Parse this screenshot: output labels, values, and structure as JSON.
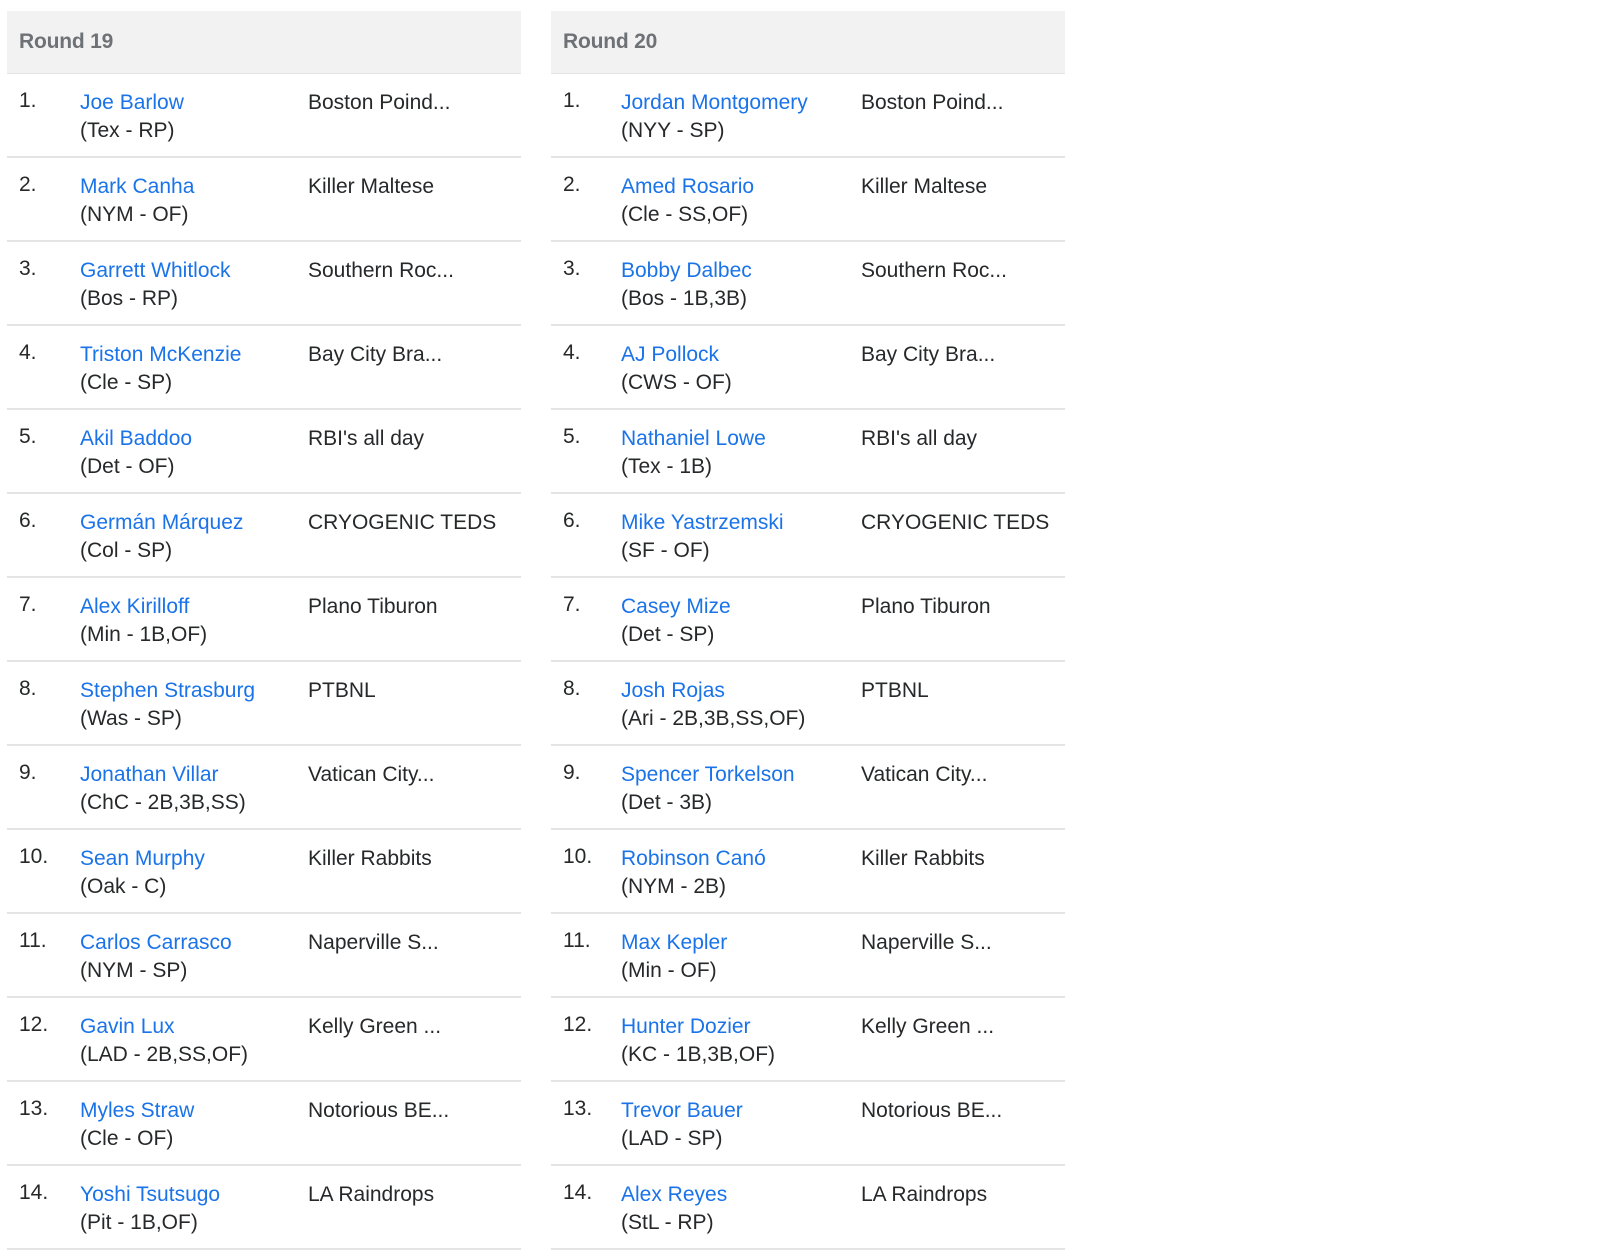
{
  "colors": {
    "link": "#1a73e8",
    "header_bg": "#f2f2f2",
    "header_text": "#6e7276",
    "divider": "#e4e4e4",
    "text": "#26282a"
  },
  "rounds": [
    {
      "title": "Round 19",
      "picks": [
        {
          "num": "1.",
          "player": "Joe Barlow",
          "meta": "(Tex - RP)",
          "team": "Boston Poind..."
        },
        {
          "num": "2.",
          "player": "Mark Canha",
          "meta": "(NYM - OF)",
          "team": "Killer Maltese"
        },
        {
          "num": "3.",
          "player": "Garrett Whitlock",
          "meta": "(Bos - RP)",
          "team": "Southern Roc..."
        },
        {
          "num": "4.",
          "player": "Triston McKenzie",
          "meta": "(Cle - SP)",
          "team": "Bay City Bra..."
        },
        {
          "num": "5.",
          "player": "Akil Baddoo",
          "meta": "(Det - OF)",
          "team": "RBI's all day"
        },
        {
          "num": "6.",
          "player": "Germán Márquez",
          "meta": "(Col - SP)",
          "team": "CRYOGENIC TEDS"
        },
        {
          "num": "7.",
          "player": "Alex Kirilloff",
          "meta": "(Min - 1B,OF)",
          "team": "Plano Tiburon"
        },
        {
          "num": "8.",
          "player": "Stephen Strasburg",
          "meta": "(Was - SP)",
          "team": "PTBNL"
        },
        {
          "num": "9.",
          "player": "Jonathan Villar",
          "meta": "(ChC - 2B,3B,SS)",
          "team": "Vatican City..."
        },
        {
          "num": "10.",
          "player": "Sean Murphy",
          "meta": "(Oak - C)",
          "team": "Killer Rabbits"
        },
        {
          "num": "11.",
          "player": "Carlos Carrasco",
          "meta": "(NYM - SP)",
          "team": "Naperville S..."
        },
        {
          "num": "12.",
          "player": "Gavin Lux",
          "meta": "(LAD - 2B,SS,OF)",
          "team": "Kelly Green ..."
        },
        {
          "num": "13.",
          "player": "Myles Straw",
          "meta": "(Cle - OF)",
          "team": "Notorious BE..."
        },
        {
          "num": "14.",
          "player": "Yoshi Tsutsugo",
          "meta": "(Pit - 1B,OF)",
          "team": "LA Raindrops"
        }
      ]
    },
    {
      "title": "Round 20",
      "picks": [
        {
          "num": "1.",
          "player": "Jordan Montgomery",
          "meta": "(NYY - SP)",
          "team": "Boston Poind..."
        },
        {
          "num": "2.",
          "player": "Amed Rosario",
          "meta": "(Cle - SS,OF)",
          "team": "Killer Maltese"
        },
        {
          "num": "3.",
          "player": "Bobby Dalbec",
          "meta": "(Bos - 1B,3B)",
          "team": "Southern Roc..."
        },
        {
          "num": "4.",
          "player": "AJ Pollock",
          "meta": "(CWS - OF)",
          "team": "Bay City Bra..."
        },
        {
          "num": "5.",
          "player": "Nathaniel Lowe",
          "meta": "(Tex - 1B)",
          "team": "RBI's all day"
        },
        {
          "num": "6.",
          "player": "Mike Yastrzemski",
          "meta": "(SF - OF)",
          "team": "CRYOGENIC TEDS"
        },
        {
          "num": "7.",
          "player": "Casey Mize",
          "meta": "(Det - SP)",
          "team": "Plano Tiburon"
        },
        {
          "num": "8.",
          "player": "Josh Rojas",
          "meta": "(Ari - 2B,3B,SS,OF)",
          "team": "PTBNL"
        },
        {
          "num": "9.",
          "player": "Spencer Torkelson",
          "meta": "(Det - 3B)",
          "team": "Vatican City..."
        },
        {
          "num": "10.",
          "player": "Robinson Canó",
          "meta": "(NYM - 2B)",
          "team": "Killer Rabbits"
        },
        {
          "num": "11.",
          "player": "Max Kepler",
          "meta": "(Min - OF)",
          "team": "Naperville S..."
        },
        {
          "num": "12.",
          "player": "Hunter Dozier",
          "meta": "(KC - 1B,3B,OF)",
          "team": "Kelly Green ..."
        },
        {
          "num": "13.",
          "player": "Trevor Bauer",
          "meta": "(LAD - SP)",
          "team": "Notorious BE..."
        },
        {
          "num": "14.",
          "player": "Alex Reyes",
          "meta": "(StL - RP)",
          "team": "LA Raindrops"
        }
      ]
    }
  ]
}
